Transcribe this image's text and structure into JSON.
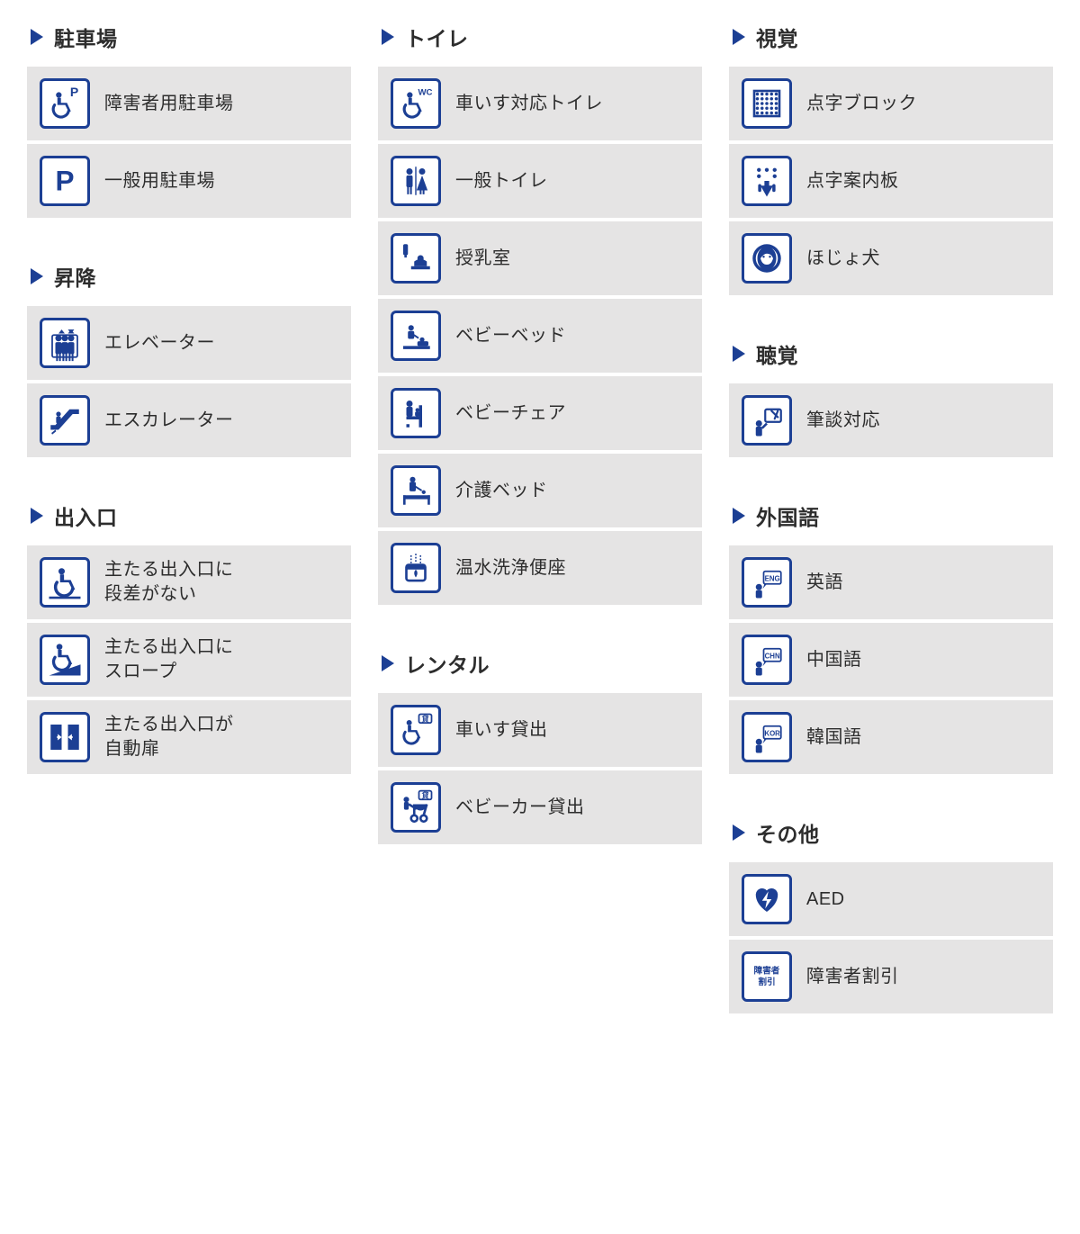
{
  "colors": {
    "accent": "#1c3f94",
    "panel": "#e5e4e4",
    "text": "#2d2d2d"
  },
  "columns": [
    {
      "sections": [
        {
          "id": "parking",
          "title": "駐車場",
          "items": [
            {
              "icon": "wheelchair-parking-icon",
              "label": "障害者用駐車場"
            },
            {
              "icon": "parking-icon",
              "label": "一般用駐車場"
            }
          ]
        },
        {
          "id": "lift",
          "title": "昇降",
          "items": [
            {
              "icon": "elevator-icon",
              "label": "エレベーター"
            },
            {
              "icon": "escalator-icon",
              "label": "エスカレーター"
            }
          ]
        },
        {
          "id": "entrance",
          "title": "出入口",
          "items": [
            {
              "icon": "entrance-flat-icon",
              "label": "主たる出入口に\n段差がない"
            },
            {
              "icon": "entrance-slope-icon",
              "label": "主たる出入口に\nスロープ"
            },
            {
              "icon": "auto-door-icon",
              "label": "主たる出入口が\n自動扉"
            }
          ]
        }
      ]
    },
    {
      "sections": [
        {
          "id": "toilet",
          "title": "トイレ",
          "items": [
            {
              "icon": "wheelchair-toilet-icon",
              "label": "車いす対応トイレ"
            },
            {
              "icon": "toilet-icon",
              "label": "一般トイレ"
            },
            {
              "icon": "nursing-room-icon",
              "label": "授乳室"
            },
            {
              "icon": "baby-bed-icon",
              "label": "ベビーベッド"
            },
            {
              "icon": "baby-chair-icon",
              "label": "ベビーチェア"
            },
            {
              "icon": "care-bed-icon",
              "label": "介護ベッド"
            },
            {
              "icon": "washlet-icon",
              "label": "温水洗浄便座"
            }
          ]
        },
        {
          "id": "rental",
          "title": "レンタル",
          "items": [
            {
              "icon": "wheelchair-rental-icon",
              "label": "車いす貸出"
            },
            {
              "icon": "stroller-rental-icon",
              "label": "ベビーカー貸出"
            }
          ]
        }
      ]
    },
    {
      "sections": [
        {
          "id": "visual",
          "title": "視覚",
          "items": [
            {
              "icon": "braille-block-icon",
              "label": "点字ブロック"
            },
            {
              "icon": "braille-board-icon",
              "label": "点字案内板"
            },
            {
              "icon": "service-dog-icon",
              "label": "ほじょ犬"
            }
          ]
        },
        {
          "id": "hearing",
          "title": "聴覚",
          "items": [
            {
              "icon": "written-conversation-icon",
              "label": "筆談対応"
            }
          ]
        },
        {
          "id": "language",
          "title": "外国語",
          "items": [
            {
              "icon": "english-icon",
              "badge": "ENG",
              "label": "英語"
            },
            {
              "icon": "chinese-icon",
              "badge": "CHN",
              "label": "中国語"
            },
            {
              "icon": "korean-icon",
              "badge": "KOR",
              "label": "韓国語"
            }
          ]
        },
        {
          "id": "other",
          "title": "その他",
          "items": [
            {
              "icon": "aed-icon",
              "label": "AED"
            },
            {
              "icon": "disabled-discount-icon",
              "badge": "障害者\n割引",
              "label": "障害者割引"
            }
          ]
        }
      ]
    }
  ]
}
